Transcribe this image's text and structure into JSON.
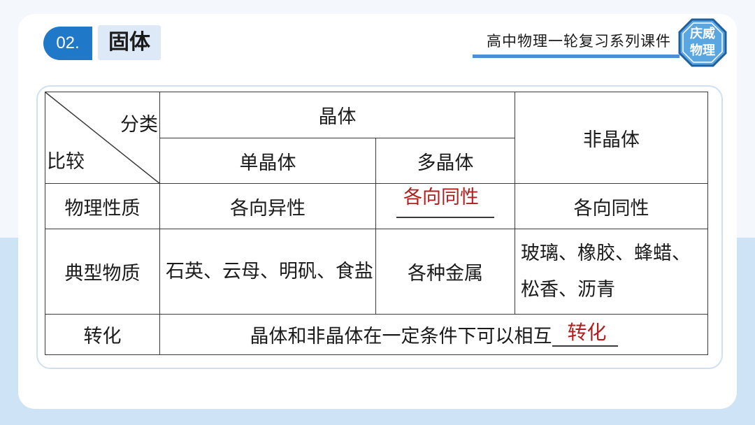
{
  "header": {
    "number": "02.",
    "title": "固体",
    "series": "高中物理一轮复习系列课件",
    "logo_line1": "庆威",
    "logo_line2": "物理"
  },
  "table": {
    "diag_top": "分类",
    "diag_bottom": "比较",
    "crystal": "晶体",
    "single_crystal": "单晶体",
    "poly_crystal": "多晶体",
    "amorphous": "非晶体",
    "rows": {
      "physical": {
        "label": "物理性质",
        "single": "各向异性",
        "poly_answer": "各向同性",
        "amorphous": "各向同性"
      },
      "typical": {
        "label": "典型物质",
        "single": "石英、云母、明矾、食盐",
        "poly": "各种金属",
        "amorphous": "玻璃、橡胶、蜂蜡、松香、沥青"
      },
      "transform": {
        "label": "转化",
        "sentence": "晶体和非晶体在一定条件下可以相互",
        "answer": "转化"
      }
    }
  },
  "colors": {
    "accent": "#1f78c8",
    "answer_red": "#b01e1e",
    "light_blue": "#cfe3f6"
  }
}
